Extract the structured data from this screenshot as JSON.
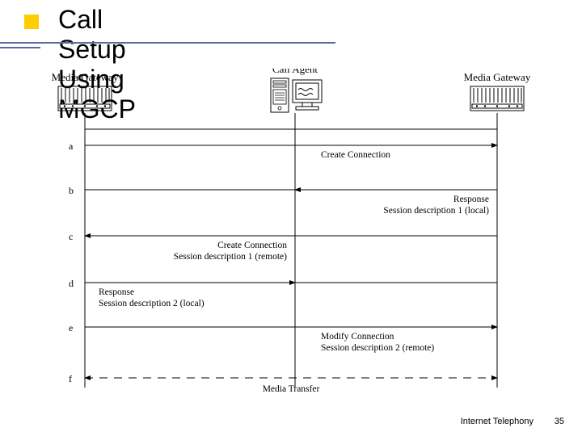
{
  "title": "Call Setup Using MGCP",
  "nodes": {
    "left_gateway": "Media Gateway",
    "call_agent": "Call Agent",
    "right_gateway": "Media Gateway"
  },
  "steps": [
    "a",
    "b",
    "c",
    "d",
    "e",
    "f"
  ],
  "messages": {
    "a": {
      "line1": "Create Connection"
    },
    "b": {
      "line1": "Response",
      "line2": "Session description 1 (local)"
    },
    "c": {
      "line1": "Create Connection",
      "line2": "Session description 1 (remote)"
    },
    "d": {
      "line1": "Response",
      "line2": "Session description 2 (local)"
    },
    "e": {
      "line1": "Modify Connection",
      "line2": "Session description 2 (remote)"
    },
    "f": {
      "line1": "Media Transfer"
    }
  },
  "footer": {
    "text": "Internet Telephony",
    "page": "35"
  }
}
